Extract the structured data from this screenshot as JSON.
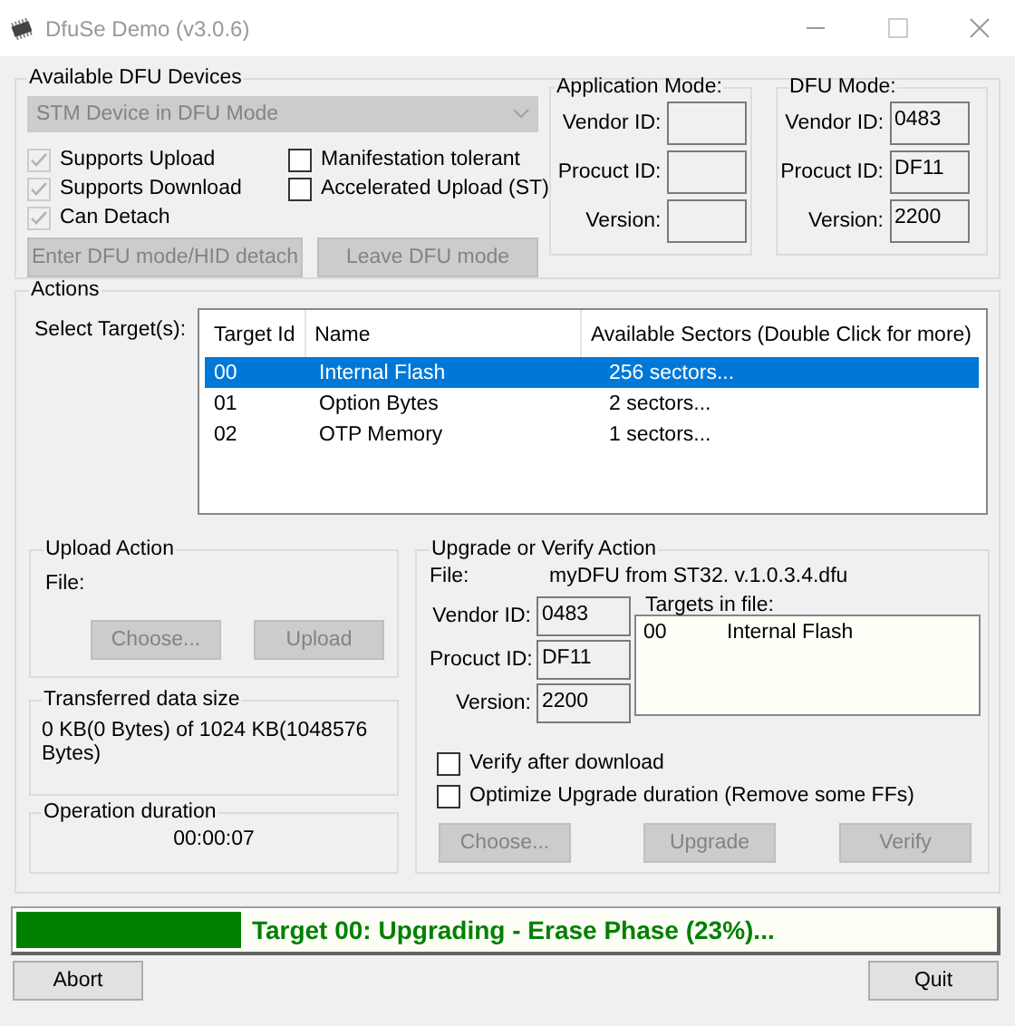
{
  "window": {
    "title": "DfuSe Demo (v3.0.6)"
  },
  "available_devices": {
    "title": "Available DFU Devices",
    "device": "STM Device in DFU Mode",
    "disabled": true,
    "options": [
      {
        "label": "Supports Upload",
        "checked": true,
        "disabled": true
      },
      {
        "label": "Manifestation tolerant",
        "checked": false,
        "disabled": false
      },
      {
        "label": "Supports Download",
        "checked": true,
        "disabled": true
      },
      {
        "label": "Accelerated Upload (ST)",
        "checked": false,
        "disabled": false
      },
      {
        "label": "Can Detach",
        "checked": true,
        "disabled": true
      }
    ],
    "buttons": [
      {
        "label": "Enter DFU mode/HID detach",
        "disabled": true
      },
      {
        "label": "Leave DFU mode",
        "disabled": true
      }
    ]
  },
  "application_mode": {
    "title": "Application Mode:",
    "fields": [
      {
        "label": "Vendor ID:"
      },
      {
        "label": "Procuct ID:"
      },
      {
        "label": "Version:"
      }
    ]
  },
  "dfu_mode": {
    "title": "DFU Mode:",
    "fields": [
      {
        "label": "Vendor ID:",
        "value": "0483"
      },
      {
        "label": "Procuct ID:",
        "value": "DF11"
      },
      {
        "label": "Version:",
        "value": "2200"
      }
    ]
  },
  "actions": {
    "title": "Actions",
    "select_label": "Select Target(s):",
    "table": {
      "columns": [
        "Target Id",
        "Name",
        "Available Sectors (Double Click for more)"
      ],
      "rows": [
        {
          "cells": [
            "00",
            "Internal Flash",
            "256 sectors..."
          ],
          "selected": true
        },
        {
          "cells": [
            "01",
            "Option Bytes",
            "2 sectors..."
          ],
          "selected": false
        },
        {
          "cells": [
            "02",
            "OTP Memory",
            "1 sectors..."
          ],
          "selected": false
        }
      ]
    },
    "upload_action": {
      "title": "Upload Action",
      "file_label": "File:",
      "buttons": [
        {
          "label": "Choose...",
          "disabled": true
        },
        {
          "label": "Upload",
          "disabled": true
        }
      ]
    },
    "transferred": {
      "title": "Transferred data size",
      "text": "0 KB(0 Bytes) of 1024 KB(1048576 Bytes)"
    },
    "duration": {
      "title": "Operation duration",
      "value": "00:00:07"
    },
    "upgrade_verify": {
      "title": "Upgrade or Verify Action",
      "file_label": "File:",
      "file": "myDFU from ST32. v.1.0.3.4.dfu",
      "fields": [
        {
          "label": "Vendor ID:",
          "value": "0483"
        },
        {
          "label": "Procuct ID:",
          "value": "DF11"
        },
        {
          "label": "Version:",
          "value": "2200"
        }
      ],
      "targets_label": "Targets in file:",
      "targets": [
        {
          "id": "00",
          "name": "Internal Flash"
        }
      ],
      "options": [
        {
          "label": "Verify after download",
          "checked": false,
          "disabled": false
        },
        {
          "label": "Optimize Upgrade duration (Remove some FFs)",
          "checked": false,
          "disabled": false
        }
      ],
      "buttons": [
        {
          "label": "Choose...",
          "disabled": true
        },
        {
          "label": "Upgrade",
          "disabled": true
        },
        {
          "label": "Verify",
          "disabled": true
        }
      ]
    }
  },
  "progress": {
    "level": 0.23,
    "text": "Target 00: Upgrading - Erase Phase (23%)..."
  },
  "buttons": [
    {
      "label": "Abort",
      "disabled": false
    },
    {
      "label": "Quit",
      "disabled": false
    }
  ]
}
